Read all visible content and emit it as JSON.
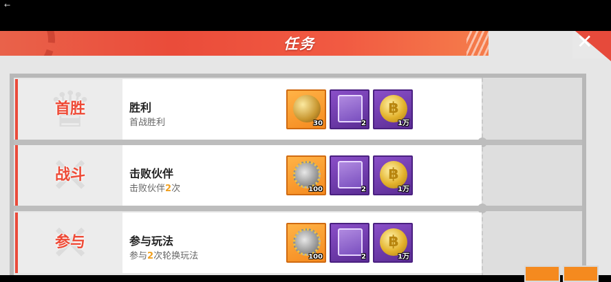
{
  "panel": {
    "title": "任务"
  },
  "controls": {
    "back_glyph": "←",
    "close_glyph": "✕"
  },
  "tasks": [
    {
      "badge": "首胜",
      "title": "胜利",
      "desc": "首战胜利",
      "rewards": [
        {
          "icon": "gold-ball-icon",
          "qty": "30"
        },
        {
          "icon": "exp-book-icon",
          "qty": "2"
        },
        {
          "icon": "gold-coin-icon",
          "qty": "1万"
        }
      ]
    },
    {
      "badge": "战斗",
      "title": "击败伙伴",
      "desc_prefix": "击败伙伴",
      "desc_count": "2",
      "desc_suffix": "次",
      "rewards": [
        {
          "icon": "gear-token-icon",
          "qty": "100"
        },
        {
          "icon": "exp-book-icon",
          "qty": "2"
        },
        {
          "icon": "gold-coin-icon",
          "qty": "1万"
        }
      ]
    },
    {
      "badge": "参与",
      "title": "参与玩法",
      "desc_prefix": "参与",
      "desc_count": "2",
      "desc_suffix": "次轮换玩法",
      "rewards": [
        {
          "icon": "gear-token-icon",
          "qty": "100"
        },
        {
          "icon": "exp-book-icon",
          "qty": "2"
        },
        {
          "icon": "gold-coin-icon",
          "qty": "1万"
        }
      ]
    }
  ],
  "colors": {
    "accent": "#ea4a3a",
    "highlight": "#f0a020",
    "reward_orange": "#f58a1f",
    "reward_purple": "#6a3aa8"
  }
}
